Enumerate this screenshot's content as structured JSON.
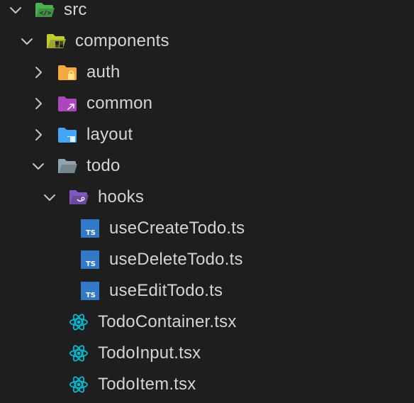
{
  "explorer": {
    "items": [
      {
        "label": "src",
        "kind": "folder-src",
        "expanded": true,
        "depth": 0
      },
      {
        "label": "components",
        "kind": "folder-components",
        "expanded": true,
        "depth": 1
      },
      {
        "label": "auth",
        "kind": "folder-auth",
        "expanded": false,
        "depth": 2
      },
      {
        "label": "common",
        "kind": "folder-common",
        "expanded": false,
        "depth": 2
      },
      {
        "label": "layout",
        "kind": "folder-layout",
        "expanded": false,
        "depth": 2
      },
      {
        "label": "todo",
        "kind": "folder-plain",
        "expanded": true,
        "depth": 2
      },
      {
        "label": "hooks",
        "kind": "folder-hooks",
        "expanded": true,
        "depth": 3
      },
      {
        "label": "useCreateTodo.ts",
        "kind": "file-ts",
        "depth": 4
      },
      {
        "label": "useDeleteTodo.ts",
        "kind": "file-ts",
        "depth": 4
      },
      {
        "label": "useEditTodo.ts",
        "kind": "file-ts",
        "depth": 4
      },
      {
        "label": "TodoContainer.tsx",
        "kind": "file-tsx",
        "depth": 3
      },
      {
        "label": "TodoInput.tsx",
        "kind": "file-tsx",
        "depth": 3
      },
      {
        "label": "TodoItem.tsx",
        "kind": "file-tsx",
        "depth": 3
      }
    ]
  },
  "icons": {
    "folder-src": "folder-src-open-icon",
    "folder-components": "folder-components-open-icon",
    "folder-auth": "folder-auth-icon",
    "folder-common": "folder-common-icon",
    "folder-layout": "folder-layout-icon",
    "folder-plain": "folder-open-icon",
    "folder-hooks": "folder-hooks-open-icon",
    "file-ts": "typescript-file-icon",
    "file-tsx": "react-file-icon",
    "chevron-open": "chevron-down-icon",
    "chevron-closed": "chevron-right-icon"
  },
  "colors": {
    "background": "#1e1e1f",
    "text": "#d4d4d4",
    "chevron": "#c5c5c5",
    "src_folder": "#4caf50",
    "components_folder": "#c0ca33",
    "auth_folder": "#f5a742",
    "common_folder": "#ab47bc",
    "layout_folder": "#42a5f5",
    "plain_folder": "#90a4ae",
    "hooks_folder": "#7e57c2",
    "typescript": "#3178c6",
    "react": "#00bcd4"
  }
}
